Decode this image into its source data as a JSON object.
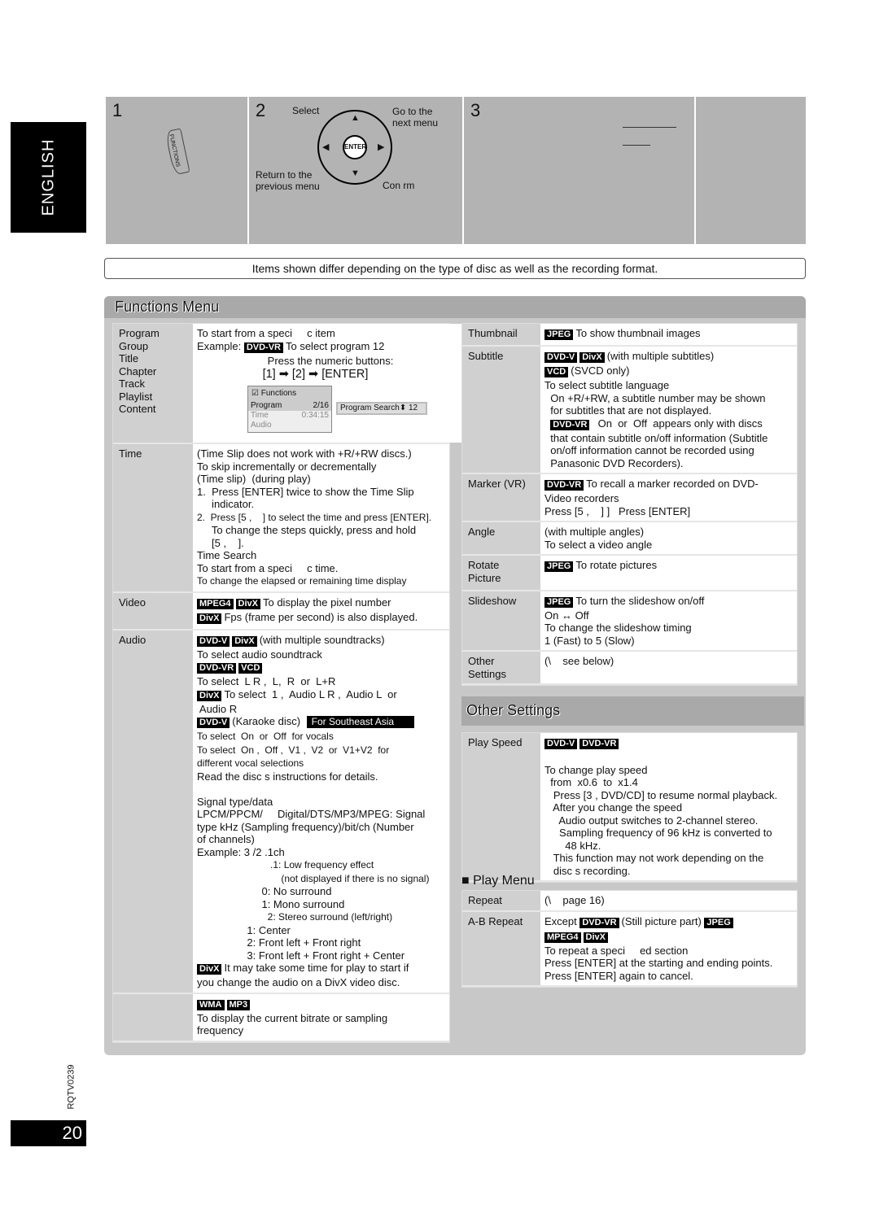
{
  "sidebar": {
    "language": "ENGLISH",
    "page_number": "20",
    "doc_code": "RQTV0239"
  },
  "steps": {
    "step1": {
      "number": "1",
      "button": "FUNCTIONS"
    },
    "step2": {
      "number": "2",
      "select": "Select",
      "go_next": "Go to the next menu",
      "enter": "ENTER",
      "return": "Return to the previous menu",
      "confirm": "Con rm"
    },
    "step3": {
      "number": "3"
    }
  },
  "notice": "Items shown differ depending on the type of disc as well as the recording format.",
  "functions_menu": {
    "title": "Functions Menu",
    "mini_screen": {
      "title": "Functions",
      "rows": [
        {
          "k": "Program",
          "v": "2/16"
        },
        {
          "k": "Time",
          "v": "0:34:15"
        },
        {
          "k": "Audio",
          "v": ""
        }
      ],
      "search_label": "Program Search",
      "search_value": "12"
    },
    "left": [
      {
        "label": "Program\nGroup\nTitle\nChapter\nTrack\nPlaylist\nContent",
        "lines": [
          [
            {
              "t": "To start from a speci     c item"
            }
          ],
          [
            {
              "t": "Example: "
            },
            {
              "b": "DVD-VR"
            },
            {
              "t": "To select program 12"
            }
          ],
          [
            {
              "t": "                        Press the numeric buttons:"
            }
          ],
          [
            {
              "big": "                    [1] ➡ [2] ➡ [ENTER]"
            }
          ],
          [
            {
              "mini": true
            }
          ]
        ]
      },
      {
        "label": "Time",
        "lines": [
          [
            {
              "t": "(Time Slip does not work with +R/+RW discs.)"
            }
          ],
          [
            {
              "t": "To skip incrementally or decrementally"
            }
          ],
          [
            {
              "t": "(Time slip)  (during play)"
            }
          ],
          [
            {
              "t": "1.  Press [ENTER] twice to show the Time Slip"
            }
          ],
          [
            {
              "t": "     indicator."
            }
          ],
          [
            {
              "s": "2.  Press [5 ,    ] to select the time and press [ENTER]."
            }
          ],
          [
            {
              "t": "     To change the steps quickly, press and hold"
            }
          ],
          [
            {
              "t": "     [5 ,    ]."
            }
          ],
          [
            {
              "t": "Time Search"
            }
          ],
          [
            {
              "t": "To start from a speci     c time."
            }
          ],
          [
            {
              "s": "To change the elapsed or remaining time display"
            }
          ]
        ]
      },
      {
        "label": "Video",
        "lines": [
          [
            {
              "b": "MPEG4"
            },
            {
              "b": "DivX"
            },
            {
              "t": "To display the pixel number"
            }
          ],
          [
            {
              "b": "DivX"
            },
            {
              "t": "Fps (frame per second) is also displayed."
            }
          ]
        ]
      },
      {
        "label": "Audio",
        "lines": [
          [
            {
              "b": "DVD-V"
            },
            {
              "b": "DivX"
            },
            {
              "t": "(with multiple soundtracks)"
            }
          ],
          [
            {
              "t": "To select audio soundtrack"
            }
          ],
          [
            {
              "b": "DVD-VR"
            },
            {
              "b": "VCD"
            }
          ],
          [
            {
              "t": "To select  L R ,  L,  R  or  L+R"
            }
          ],
          [
            {
              "b": "DivX"
            },
            {
              "t": "To select  1 ,  Audio L R ,  Audio L  or"
            }
          ],
          [
            {
              "t": " Audio R"
            }
          ],
          [
            {
              "b": "DVD-V"
            },
            {
              "t": "(Karaoke disc) "
            },
            {
              "w": "For Southeast Asia"
            }
          ],
          [
            {
              "s": "To select  On  or  Off  for vocals"
            }
          ],
          [
            {
              "s": "To select  On ,  Off ,  V1 ,  V2  or  V1+V2  for"
            }
          ],
          [
            {
              "s": "different vocal selections"
            }
          ],
          [
            {
              "t": "Read the disc s instructions for details."
            }
          ],
          [
            {
              "t": ""
            }
          ],
          [
            {
              "t": "Signal type/data"
            }
          ],
          [
            {
              "t": "LPCM/PPCM/     Digital/DTS/MP3/MPEG: Signal"
            }
          ],
          [
            {
              "t": "type kHz (Sampling frequency)/bit/ch (Number"
            }
          ],
          [
            {
              "t": "of channels)"
            }
          ],
          [
            {
              "t": "Example: 3 /2 .1ch"
            }
          ],
          [
            {
              "s": "                           .1: Low frequency effect"
            }
          ],
          [
            {
              "s": "                               (not displayed if there is no signal)"
            }
          ],
          [
            {
              "t": "                      0: No surround"
            }
          ],
          [
            {
              "t": "                      1: Mono surround"
            }
          ],
          [
            {
              "s": "                          2: Stereo surround (left/right)"
            }
          ],
          [
            {
              "t": "                 1: Center"
            }
          ],
          [
            {
              "t": "                 2: Front left + Front right"
            }
          ],
          [
            {
              "t": "                 3: Front left + Front right + Center"
            }
          ],
          [
            {
              "b": "DivX"
            },
            {
              "t": "It may take some time for play to start if"
            }
          ],
          [
            {
              "t": "you change the audio on a DivX video disc."
            }
          ]
        ]
      },
      {
        "label": "",
        "lines": [
          [
            {
              "b": "WMA"
            },
            {
              "b": "MP3"
            }
          ],
          [
            {
              "t": "To display the current bitrate or sampling"
            }
          ],
          [
            {
              "t": "frequency"
            }
          ]
        ]
      }
    ],
    "right": [
      {
        "label": "Thumbnail",
        "lines": [
          [
            {
              "b": "JPEG"
            },
            {
              "t": "To show thumbnail images"
            }
          ]
        ]
      },
      {
        "label": "Subtitle",
        "lines": [
          [
            {
              "b": "DVD-V"
            },
            {
              "b": "DivX"
            },
            {
              "t": "(with multiple subtitles)"
            }
          ],
          [
            {
              "b": "VCD"
            },
            {
              "t": "(SVCD only)"
            }
          ],
          [
            {
              "t": "To select subtitle language"
            }
          ],
          [
            {
              "t": "  On +R/+RW, a subtitle number may be shown"
            }
          ],
          [
            {
              "t": "  for subtitles that are not displayed."
            }
          ],
          [
            {
              "t": "  "
            },
            {
              "b": "DVD-VR"
            },
            {
              "t": "  On  or  Off  appears only with discs"
            }
          ],
          [
            {
              "t": "  that contain subtitle on/off information (Subtitle"
            }
          ],
          [
            {
              "t": "  on/off information cannot be recorded using"
            }
          ],
          [
            {
              "t": "  Panasonic DVD Recorders)."
            }
          ]
        ]
      },
      {
        "label": "Marker (VR)",
        "lines": [
          [
            {
              "b": "DVD-VR"
            },
            {
              "t": "To recall a marker recorded on DVD-"
            }
          ],
          [
            {
              "t": "Video recorders"
            }
          ],
          [
            {
              "t": "Press [5 ,    ] ]   Press [ENTER]"
            }
          ]
        ]
      },
      {
        "label": "Angle",
        "lines": [
          [
            {
              "t": "(with multiple angles)"
            }
          ],
          [
            {
              "t": "To select a video angle"
            }
          ]
        ]
      },
      {
        "label": "Rotate\nPicture",
        "lines": [
          [
            {
              "b": "JPEG"
            },
            {
              "t": "To rotate pictures"
            }
          ],
          [
            {
              "t": ""
            }
          ]
        ]
      },
      {
        "label": "Slideshow",
        "lines": [
          [
            {
              "b": "JPEG"
            },
            {
              "t": "To turn the slideshow on/off"
            }
          ],
          [
            {
              "t": "On ↔ Off"
            }
          ],
          [
            {
              "t": "To change the slideshow timing"
            }
          ],
          [
            {
              "t": "1 (Fast) to 5 (Slow)"
            }
          ]
        ]
      },
      {
        "label": "Other\nSettings",
        "lines": [
          [
            {
              "t": "(\\    see below)"
            }
          ],
          [
            {
              "t": ""
            }
          ]
        ]
      }
    ]
  },
  "other_settings": {
    "title": "Other Settings",
    "rows": [
      {
        "label": "Play Speed",
        "lines": [
          [
            {
              "b": "DVD-V"
            },
            {
              "b": "DVD-VR"
            }
          ],
          [
            {
              "t": ""
            }
          ],
          [
            {
              "t": "To change play speed"
            }
          ],
          [
            {
              "t": "  from  x0.6  to  x1.4"
            }
          ],
          [
            {
              "t": "   Press [3 , DVD/CD] to resume normal playback."
            }
          ],
          [
            {
              "t": "   After you change the speed"
            }
          ],
          [
            {
              "t": "     Audio output switches to 2-channel stereo."
            }
          ],
          [
            {
              "t": "     Sampling frequency of 96 kHz is converted to"
            }
          ],
          [
            {
              "t": "       48 kHz."
            }
          ],
          [
            {
              "t": "   This function may not work depending on the"
            }
          ],
          [
            {
              "t": "   disc s recording."
            }
          ]
        ]
      }
    ]
  },
  "play_menu": {
    "title": "■ Play Menu",
    "rows": [
      {
        "label": "Repeat",
        "lines": [
          [
            {
              "t": "(\\    page 16)"
            }
          ]
        ]
      },
      {
        "label": "A-B Repeat",
        "lines": [
          [
            {
              "t": "Except "
            },
            {
              "b": "DVD-VR"
            },
            {
              "t": "(Still picture part) "
            },
            {
              "b": "JPEG"
            }
          ],
          [
            {
              "b": "MPEG4"
            },
            {
              "b": "DivX"
            }
          ],
          [
            {
              "t": "To repeat a speci     ed section"
            }
          ],
          [
            {
              "t": "Press [ENTER] at the starting and ending points."
            }
          ],
          [
            {
              "t": "Press [ENTER] again to cancel."
            }
          ]
        ]
      }
    ]
  }
}
